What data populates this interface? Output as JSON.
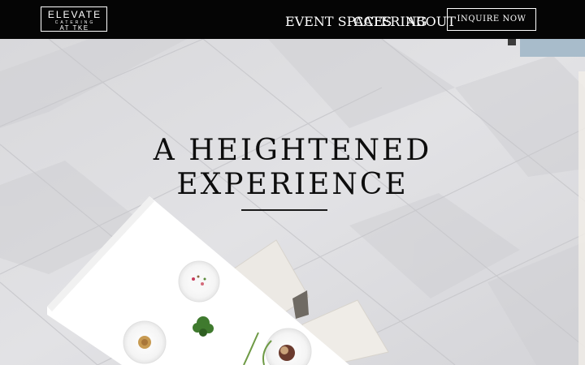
{
  "logo": {
    "line1": "ELEVATE",
    "line2": "CATERING",
    "line3": "AT TKE"
  },
  "nav": {
    "items": [
      {
        "label": "EVENT SPACES"
      },
      {
        "label": "CATERING"
      },
      {
        "label": "ABOUT"
      }
    ],
    "cta_label": "INQUIRE NOW"
  },
  "hero": {
    "headline_line1": "A HEIGHTENED",
    "headline_line2": "EXPERIENCE"
  },
  "colors": {
    "header_bg": "#050505",
    "header_text": "#ffffff",
    "headline_text": "#0d0d0d",
    "floor_tile": "#dcdcdf",
    "table_top": "#ffffff"
  }
}
